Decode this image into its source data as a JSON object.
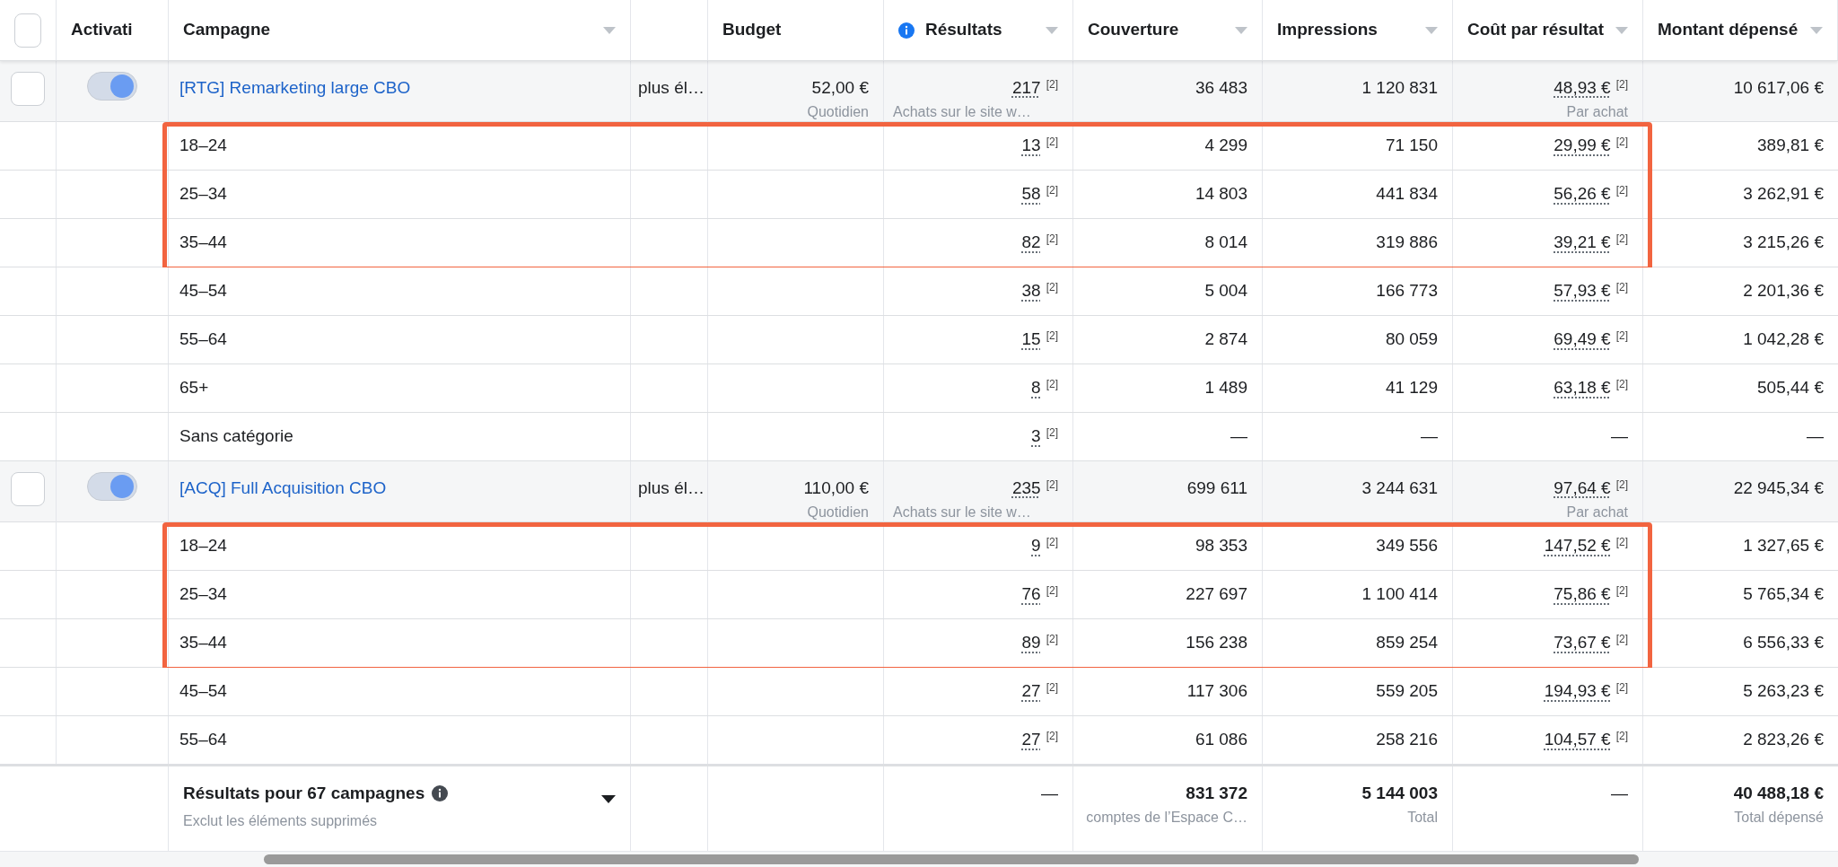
{
  "header": {
    "columns": [
      {
        "kind": "checkbox",
        "checked": false
      },
      {
        "kind": "plain",
        "label": "Activati"
      },
      {
        "kind": "sortable",
        "label": "Campagne"
      },
      {
        "kind": "blank"
      },
      {
        "kind": "plain",
        "label": "Budget"
      },
      {
        "kind": "info_sortable",
        "label": "Résultats"
      },
      {
        "kind": "sortable",
        "label": "Couverture"
      },
      {
        "kind": "sortable",
        "label": "Impressions"
      },
      {
        "kind": "sortable",
        "label": "Coût par résultat"
      },
      {
        "kind": "sortable",
        "label": "Montant dépensé"
      }
    ]
  },
  "campaigns": [
    {
      "checked": false,
      "on": true,
      "name": "[RTG] Remarketing large CBO",
      "delivery": "plus él…",
      "budget": "52,00 €",
      "budget_type": "Quotidien",
      "results": "217",
      "results_note": "[2]",
      "result_type": "Achats sur le site w…",
      "reach": "36 483",
      "impressions": "1 120 831",
      "cost": "48,93 €",
      "cost_note": "[2]",
      "cost_type": "Par achat",
      "spent": "10 617,06 €",
      "groups": [
        {
          "highlighted": true,
          "rows": [
            {
              "label": "18–24",
              "results": "13",
              "results_note": "[2]",
              "reach": "4 299",
              "impressions": "71 150",
              "cost": "29,99 €",
              "cost_note": "[2]",
              "spent": "389,81 €"
            },
            {
              "label": "25–34",
              "results": "58",
              "results_note": "[2]",
              "reach": "14 803",
              "impressions": "441 834",
              "cost": "56,26 €",
              "cost_note": "[2]",
              "spent": "3 262,91 €"
            },
            {
              "label": "35–44",
              "results": "82",
              "results_note": "[2]",
              "reach": "8 014",
              "impressions": "319 886",
              "cost": "39,21 €",
              "cost_note": "[2]",
              "spent": "3 215,26 €"
            }
          ]
        },
        {
          "highlighted": false,
          "rows": [
            {
              "label": "45–54",
              "results": "38",
              "results_note": "[2]",
              "reach": "5 004",
              "impressions": "166 773",
              "cost": "57,93 €",
              "cost_note": "[2]",
              "spent": "2 201,36 €"
            },
            {
              "label": "55–64",
              "results": "15",
              "results_note": "[2]",
              "reach": "2 874",
              "impressions": "80 059",
              "cost": "69,49 €",
              "cost_note": "[2]",
              "spent": "1 042,28 €"
            },
            {
              "label": "65+",
              "results": "8",
              "results_note": "[2]",
              "reach": "1 489",
              "impressions": "41 129",
              "cost": "63,18 €",
              "cost_note": "[2]",
              "spent": "505,44 €"
            },
            {
              "label": "Sans catégorie",
              "results": "3",
              "results_note": "[2]",
              "reach": "—",
              "impressions": "—",
              "cost": "—",
              "spent": "—"
            }
          ]
        }
      ]
    },
    {
      "checked": false,
      "on": true,
      "name": "[ACQ] Full Acquisition CBO",
      "delivery": "plus él…",
      "budget": "110,00 €",
      "budget_type": "Quotidien",
      "results": "235",
      "results_note": "[2]",
      "result_type": "Achats sur le site w…",
      "reach": "699 611",
      "impressions": "3 244 631",
      "cost": "97,64 €",
      "cost_note": "[2]",
      "cost_type": "Par achat",
      "spent": "22 945,34 €",
      "groups": [
        {
          "highlighted": true,
          "rows": [
            {
              "label": "18–24",
              "results": "9",
              "results_note": "[2]",
              "reach": "98 353",
              "impressions": "349 556",
              "cost": "147,52 €",
              "cost_note": "[2]",
              "spent": "1 327,65 €"
            },
            {
              "label": "25–34",
              "results": "76",
              "results_note": "[2]",
              "reach": "227 697",
              "impressions": "1 100 414",
              "cost": "75,86 €",
              "cost_note": "[2]",
              "spent": "5 765,34 €"
            },
            {
              "label": "35–44",
              "results": "89",
              "results_note": "[2]",
              "reach": "156 238",
              "impressions": "859 254",
              "cost": "73,67 €",
              "cost_note": "[2]",
              "spent": "6 556,33 €"
            }
          ]
        },
        {
          "highlighted": false,
          "rows": [
            {
              "label": "45–54",
              "results": "27",
              "results_note": "[2]",
              "reach": "117 306",
              "impressions": "559 205",
              "cost": "194,93 €",
              "cost_note": "[2]",
              "spent": "5 263,23 €"
            },
            {
              "label": "55–64",
              "results": "27",
              "results_note": "[2]",
              "reach": "61 086",
              "impressions": "258 216",
              "cost": "104,57 €",
              "cost_note": "[2]",
              "spent": "2 823,26 €"
            }
          ]
        }
      ]
    }
  ],
  "footer": {
    "title": "Résultats pour 67 campagnes",
    "subtitle": "Exclut les éléments supprimés",
    "results": "—",
    "reach": "831 372",
    "reach_label": "comptes de l’Espace C…",
    "impressions": "5 144 003",
    "impressions_label": "Total",
    "cost": "—",
    "spent": "40 488,18 €",
    "spent_label": "Total dépensé"
  }
}
